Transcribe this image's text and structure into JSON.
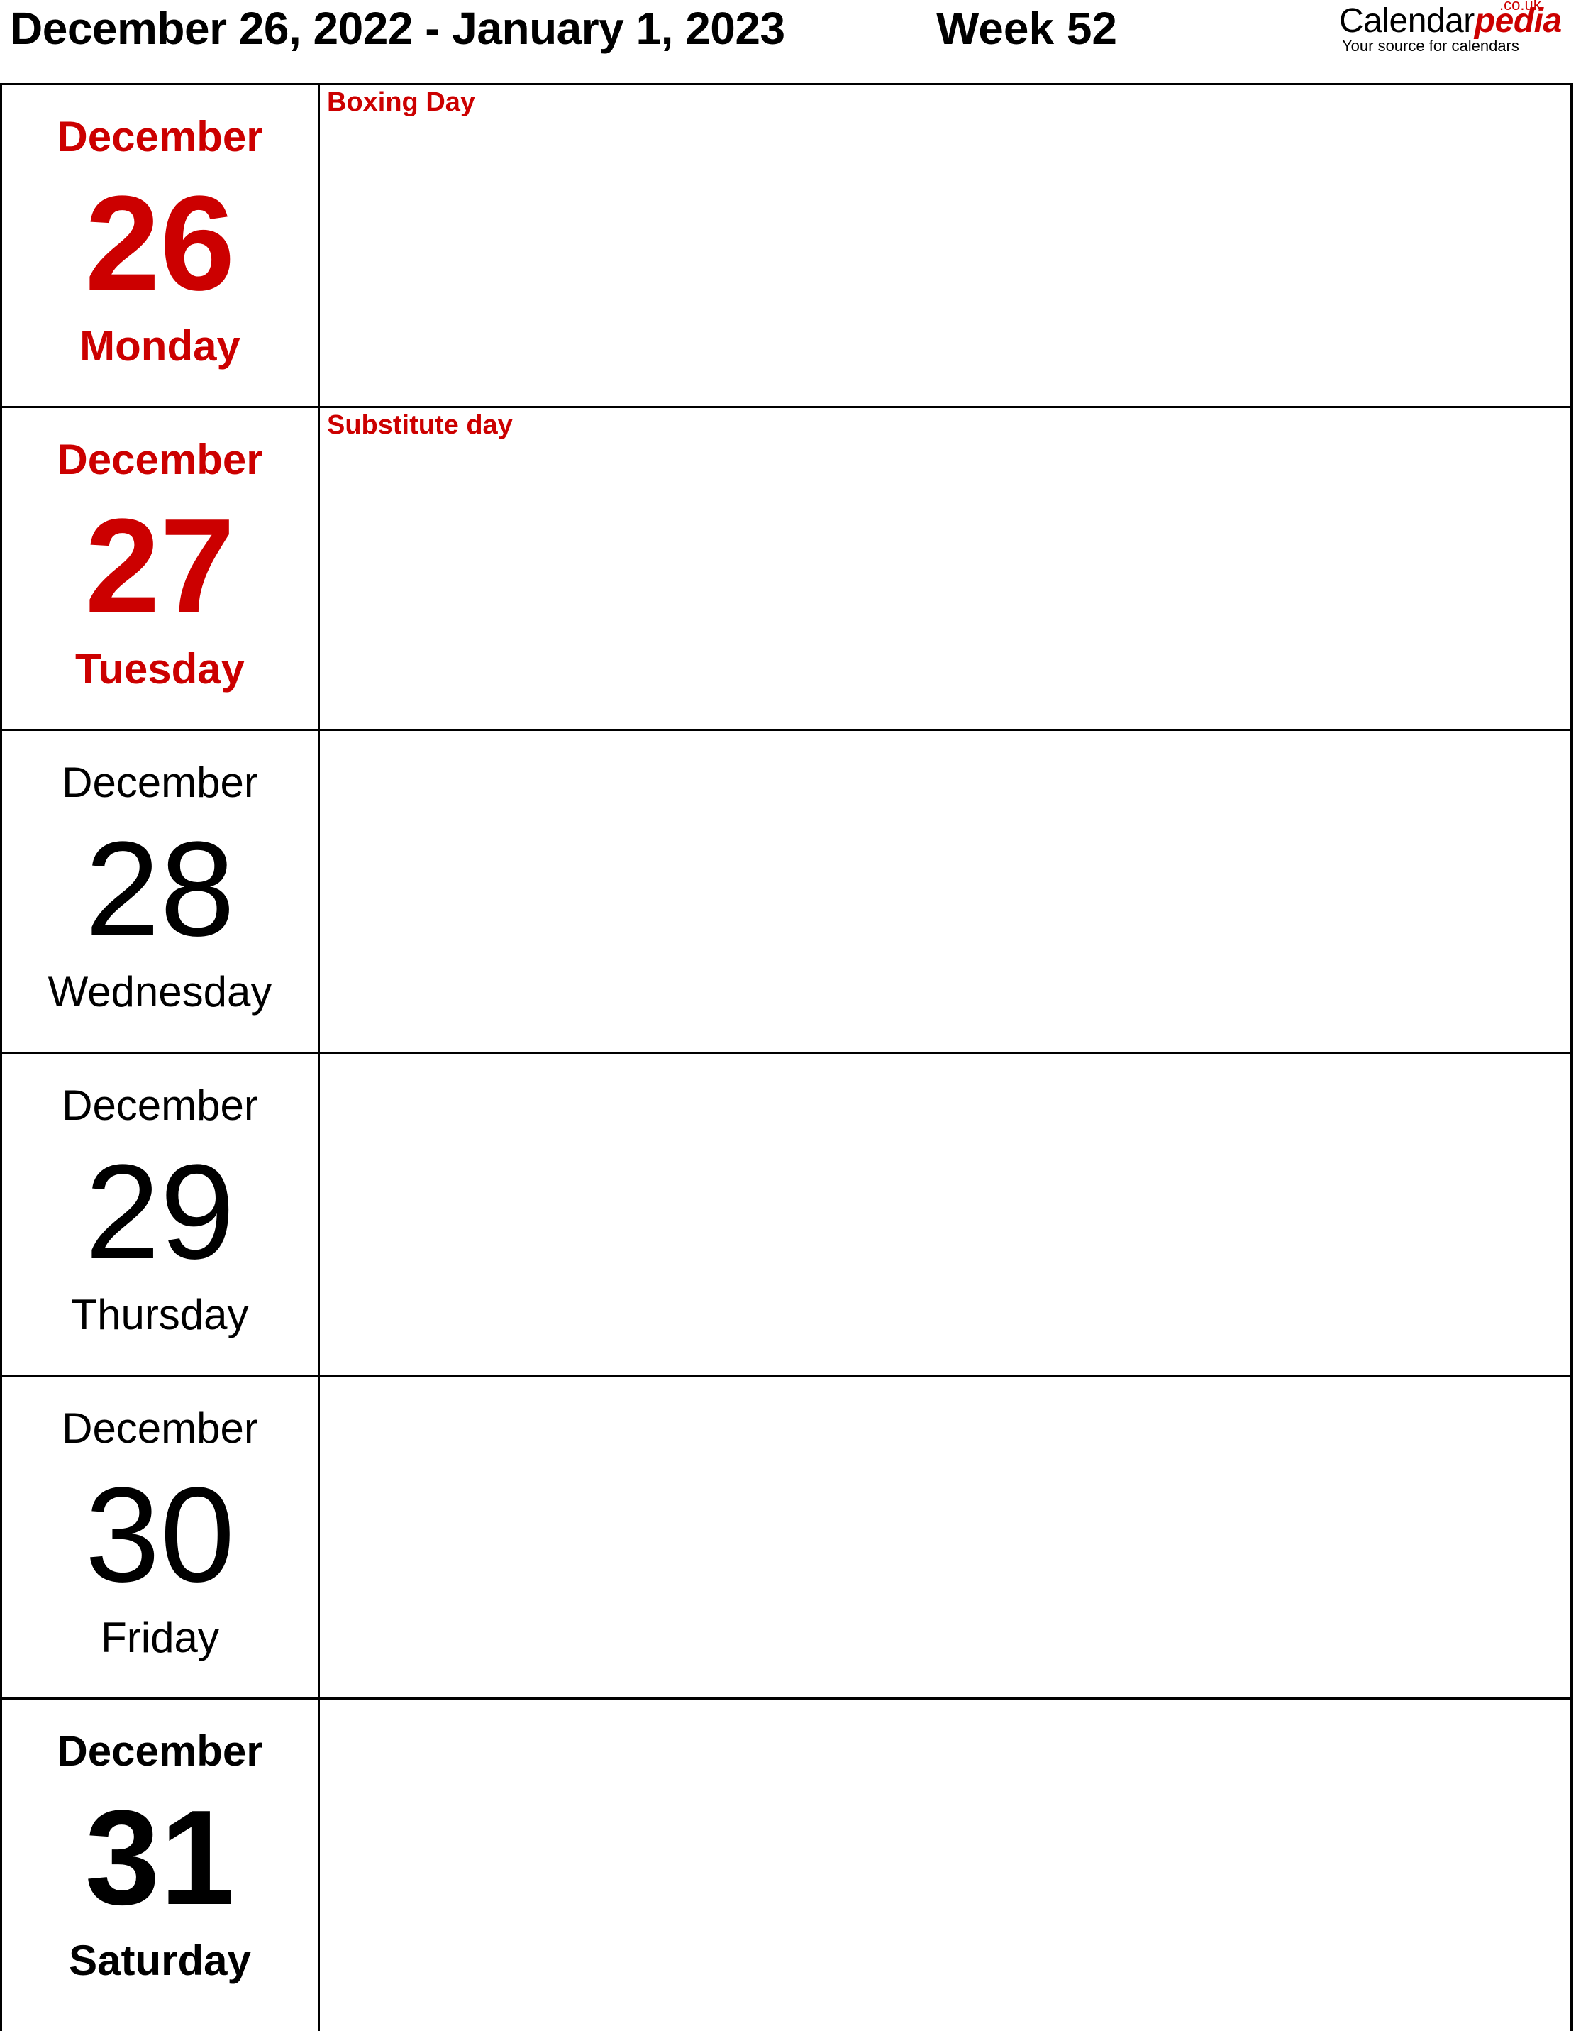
{
  "header": {
    "title": "December 26, 2022 - January 1, 2023",
    "week": "Week 52"
  },
  "logo": {
    "brand_plain": "Calendar",
    "brand_accent": "pedia",
    "tld": ".co.uk",
    "tagline": "Your source for calendars",
    "accent_color": "#cc0000"
  },
  "colors": {
    "holiday": "#cc0000",
    "text": "#000000",
    "border": "#000000"
  },
  "days": [
    {
      "month": "December",
      "day": "26",
      "weekday": "Monday",
      "note": "Boxing Day",
      "style": "holiday"
    },
    {
      "month": "December",
      "day": "27",
      "weekday": "Tuesday",
      "note": "Substitute day",
      "style": "holiday"
    },
    {
      "month": "December",
      "day": "28",
      "weekday": "Wednesday",
      "note": "",
      "style": "normal"
    },
    {
      "month": "December",
      "day": "29",
      "weekday": "Thursday",
      "note": "",
      "style": "normal"
    },
    {
      "month": "December",
      "day": "30",
      "weekday": "Friday",
      "note": "",
      "style": "normal"
    },
    {
      "month": "December",
      "day": "31",
      "weekday": "Saturday",
      "note": "",
      "style": "weekend"
    }
  ]
}
